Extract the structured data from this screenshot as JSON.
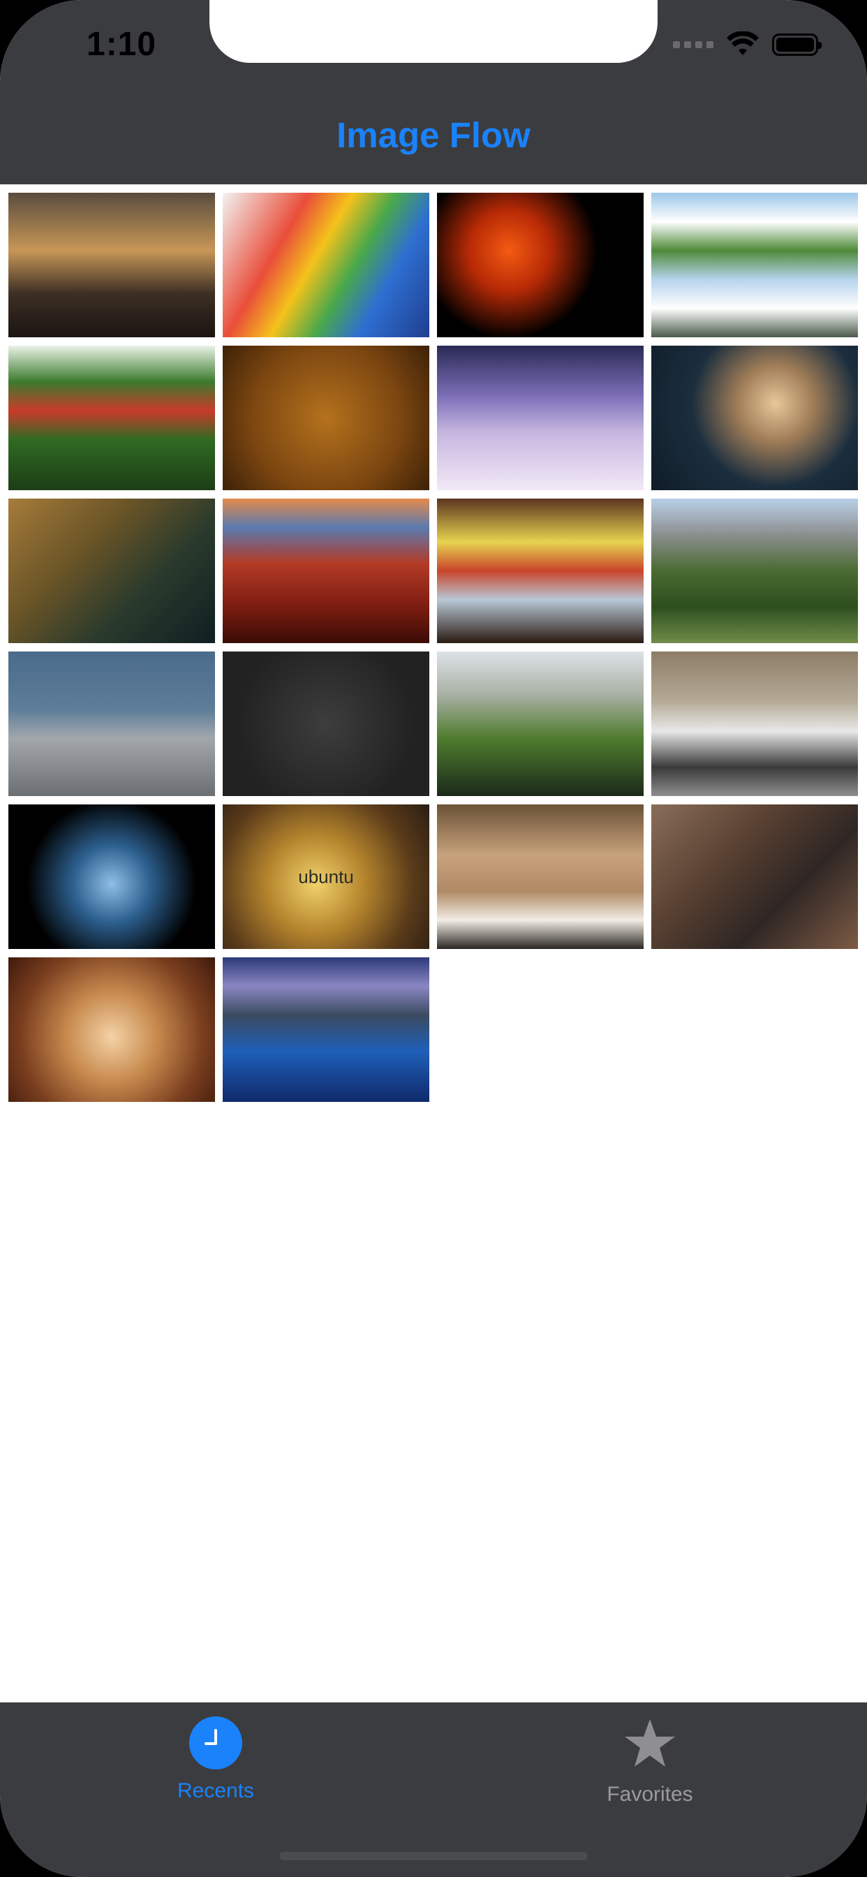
{
  "status_bar": {
    "time": "1:10"
  },
  "nav": {
    "title": "Image Flow"
  },
  "grid": {
    "tiles": [
      {
        "icon": "woman-ships-sunset-image",
        "bg": "linear-gradient(180deg,#5b4c3e 0%,#c79757 40%,#3d2f25 70%,#1b1410 100%)",
        "caption": ""
      },
      {
        "icon": "colored-pencils-image",
        "bg": "linear-gradient(120deg,#f2f2f2 0%,#e94e3a 30%,#f5c21b 45%,#4aa84b 60%,#2e6fd1 75%,#1f3e8f 100%)",
        "caption": ""
      },
      {
        "icon": "fire-ice-yin-yang-image",
        "bg": "radial-gradient(circle at 35% 40%,#f45b12 0%,#b82a06 25%,#000 55%),radial-gradient(circle at 65% 60%,#2f7cf0 0%,#0a2c7a 25%,#000 55%)",
        "caption": ""
      },
      {
        "icon": "mountain-lake-reflection-image",
        "bg": "linear-gradient(180deg,#9cc7e8 0%,#ffffff 20%,#4e8a3a 40%,#b7d4ee 60%,#ffffff 80%,#4a5a4a 100%)",
        "caption": ""
      },
      {
        "icon": "forest-pond-image",
        "bg": "linear-gradient(180deg,#e9f2e6 0%,#3c7a2d 25%,#c93b2a 45%,#2f6b22 65%,#1d3d17 100%)",
        "caption": ""
      },
      {
        "icon": "dragon-pattern-image",
        "bg": "radial-gradient(circle,#b5721d 0%,#7a4510 60%,#3d2107 100%)",
        "caption": ""
      },
      {
        "icon": "fantasy-planet-woman-image",
        "bg": "linear-gradient(180deg,#2a2a55 0%,#7c6fb8 35%,#c6b6e0 60%,#f2e9f6 100%)",
        "caption": ""
      },
      {
        "icon": "portrait-woman-image",
        "bg": "radial-gradient(circle at 60% 40%,#e8c79a 0%,#a07d57 25%,#1b2e3e 55%,#0f1c27 100%)",
        "caption": ""
      },
      {
        "icon": "old-book-candle-image",
        "bg": "linear-gradient(135deg,#a67c3a 0%,#6b5527 35%,#2a3a2c 65%,#0f1f22 100%)",
        "caption": ""
      },
      {
        "icon": "red-canyon-sunset-image",
        "bg": "linear-gradient(180deg,#e58a4b 0%,#5a7ab0 20%,#b33a25 45%,#7c1c10 75%,#3a0c06 100%)",
        "caption": ""
      },
      {
        "icon": "abstract-streaks-image",
        "bg": "linear-gradient(180deg,#5c3520 0%,#e7d34f 30%,#c9452a 50%,#b8c8d6 70%,#2a1a12 100%)",
        "caption": ""
      },
      {
        "icon": "green-mountains-image",
        "bg": "linear-gradient(180deg,#b9d0e8 0%,#8c8f8f 25%,#4a6b32 50%,#2d4f1e 75%,#718c4a 100%)",
        "caption": ""
      },
      {
        "icon": "silver-sports-car-image",
        "bg": "linear-gradient(180deg,#4a6b8a 0%,#5d7d99 40%,#a3a7ac 60%,#6b6f73 100%)",
        "caption": ""
      },
      {
        "icon": "war-text-image",
        "bg": "radial-gradient(circle,#3d3d3d 0%,#222 70%)",
        "caption": ""
      },
      {
        "icon": "waterfall-cave-image",
        "bg": "linear-gradient(180deg,#dde3e6 0%,#a9b0a4 30%,#4f7c2e 60%,#1b2a1a 100%)",
        "caption": ""
      },
      {
        "icon": "white-muscle-car-image",
        "bg": "linear-gradient(180deg,#8d7d66 0%,#b6ab98 35%,#e8e8e8 55%,#3a3a3a 80%,#8e8e8e 100%)",
        "caption": ""
      },
      {
        "icon": "ice-phoenix-image",
        "bg": "radial-gradient(circle at 50% 55%,#8fbfe6 0%,#2c5f8e 30%,#000 65%)",
        "caption": ""
      },
      {
        "icon": "ubuntu-bokeh-image",
        "bg": "radial-gradient(circle at 45% 55%,#f0d26b 0%,#b5852d 35%,#5a3b1a 70%,#2a1d12 100%)",
        "caption": "ubuntu"
      },
      {
        "icon": "kitten-blanket-image",
        "bg": "linear-gradient(180deg,#6b5236 0%,#c7a27c 35%,#b08a65 60%,#f2ede5 80%,#2b2723 100%)",
        "caption": ""
      },
      {
        "icon": "fantasy-creature-image",
        "bg": "linear-gradient(135deg,#8a6d5a 0%,#5a4232 35%,#2f2624 65%,#7c5b44 100%)",
        "caption": ""
      },
      {
        "icon": "strawberries-chocolate-image",
        "bg": "radial-gradient(circle at 50% 55%,#f4d2a6 0%,#c7894d 35%,#7a3e1f 70%,#3f1a0b 100%)",
        "caption": ""
      },
      {
        "icon": "blue-lake-pier-image",
        "bg": "linear-gradient(180deg,#2d3a7a 0%,#8a86c3 20%,#3b4b60 40%,#1f5fb8 65%,#0f2a6b 100%)",
        "caption": ""
      }
    ]
  },
  "tabbar": {
    "recents": {
      "label": "Recents",
      "icon": "clock-icon",
      "color": "#1a82fb"
    },
    "favorites": {
      "label": "Favorites",
      "icon": "star-icon",
      "color": "#9a9a9e"
    }
  }
}
